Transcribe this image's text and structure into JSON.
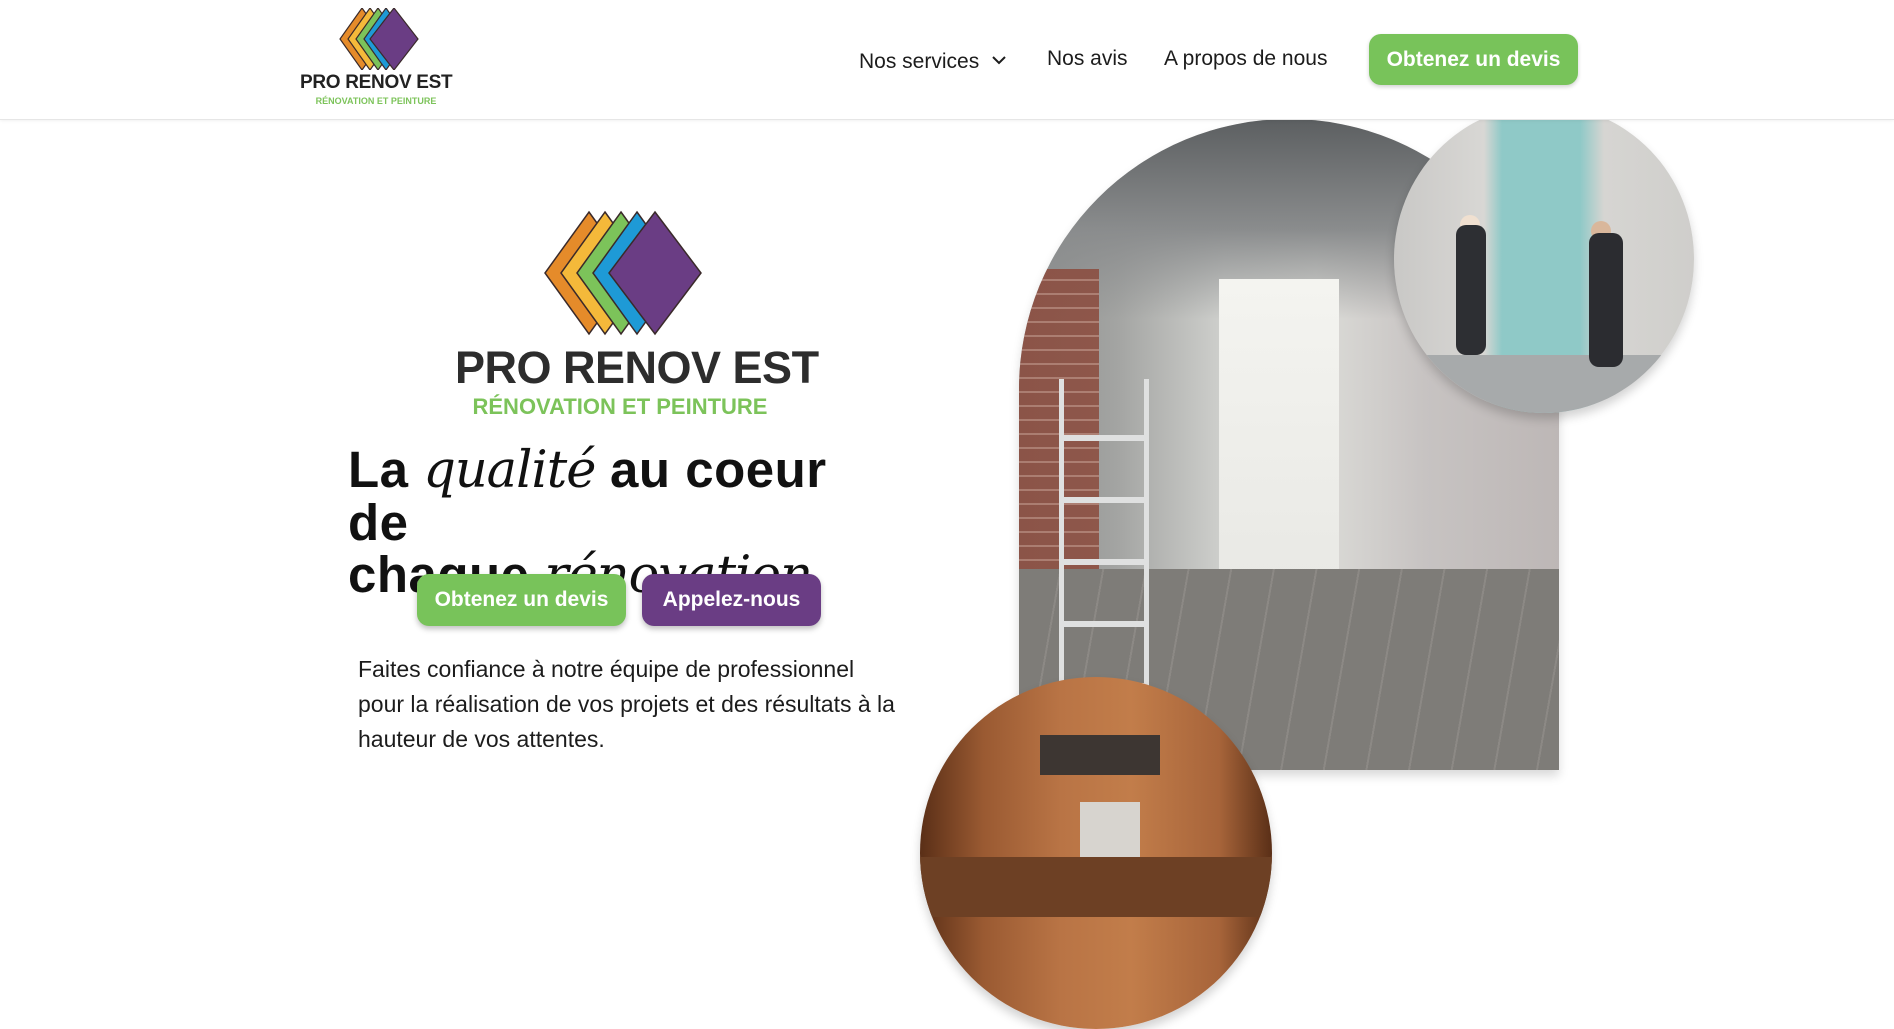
{
  "brand": {
    "name": "PRO RENOV EST",
    "tagline": "RÉNOVATION ET PEINTURE",
    "colors": {
      "orange": "#e58b2a",
      "yellow": "#f4b93a",
      "green": "#7cc35a",
      "blue": "#1e9ad6",
      "purple": "#6a3d84"
    }
  },
  "nav": {
    "services": "Nos services",
    "services_icon": "chevron-down-icon",
    "avis": "Nos avis",
    "apropos": "A propos de nous",
    "cta": "Obtenez un devis"
  },
  "hero": {
    "headline_a": "La ",
    "headline_b": "qualité",
    "headline_c": " au coeur de",
    "headline_d": "chaque ",
    "headline_e": "rénovation",
    "btn_devis": "Obtenez un devis",
    "btn_call": "Appelez-nous",
    "description": "Faites confiance à notre équipe de professionnel pour la réalisation de vos projets et des résultats à la hauteur de vos attentes."
  },
  "theme": {
    "green": "#78c35a",
    "purple": "#6a3d84",
    "text": "#111111"
  }
}
